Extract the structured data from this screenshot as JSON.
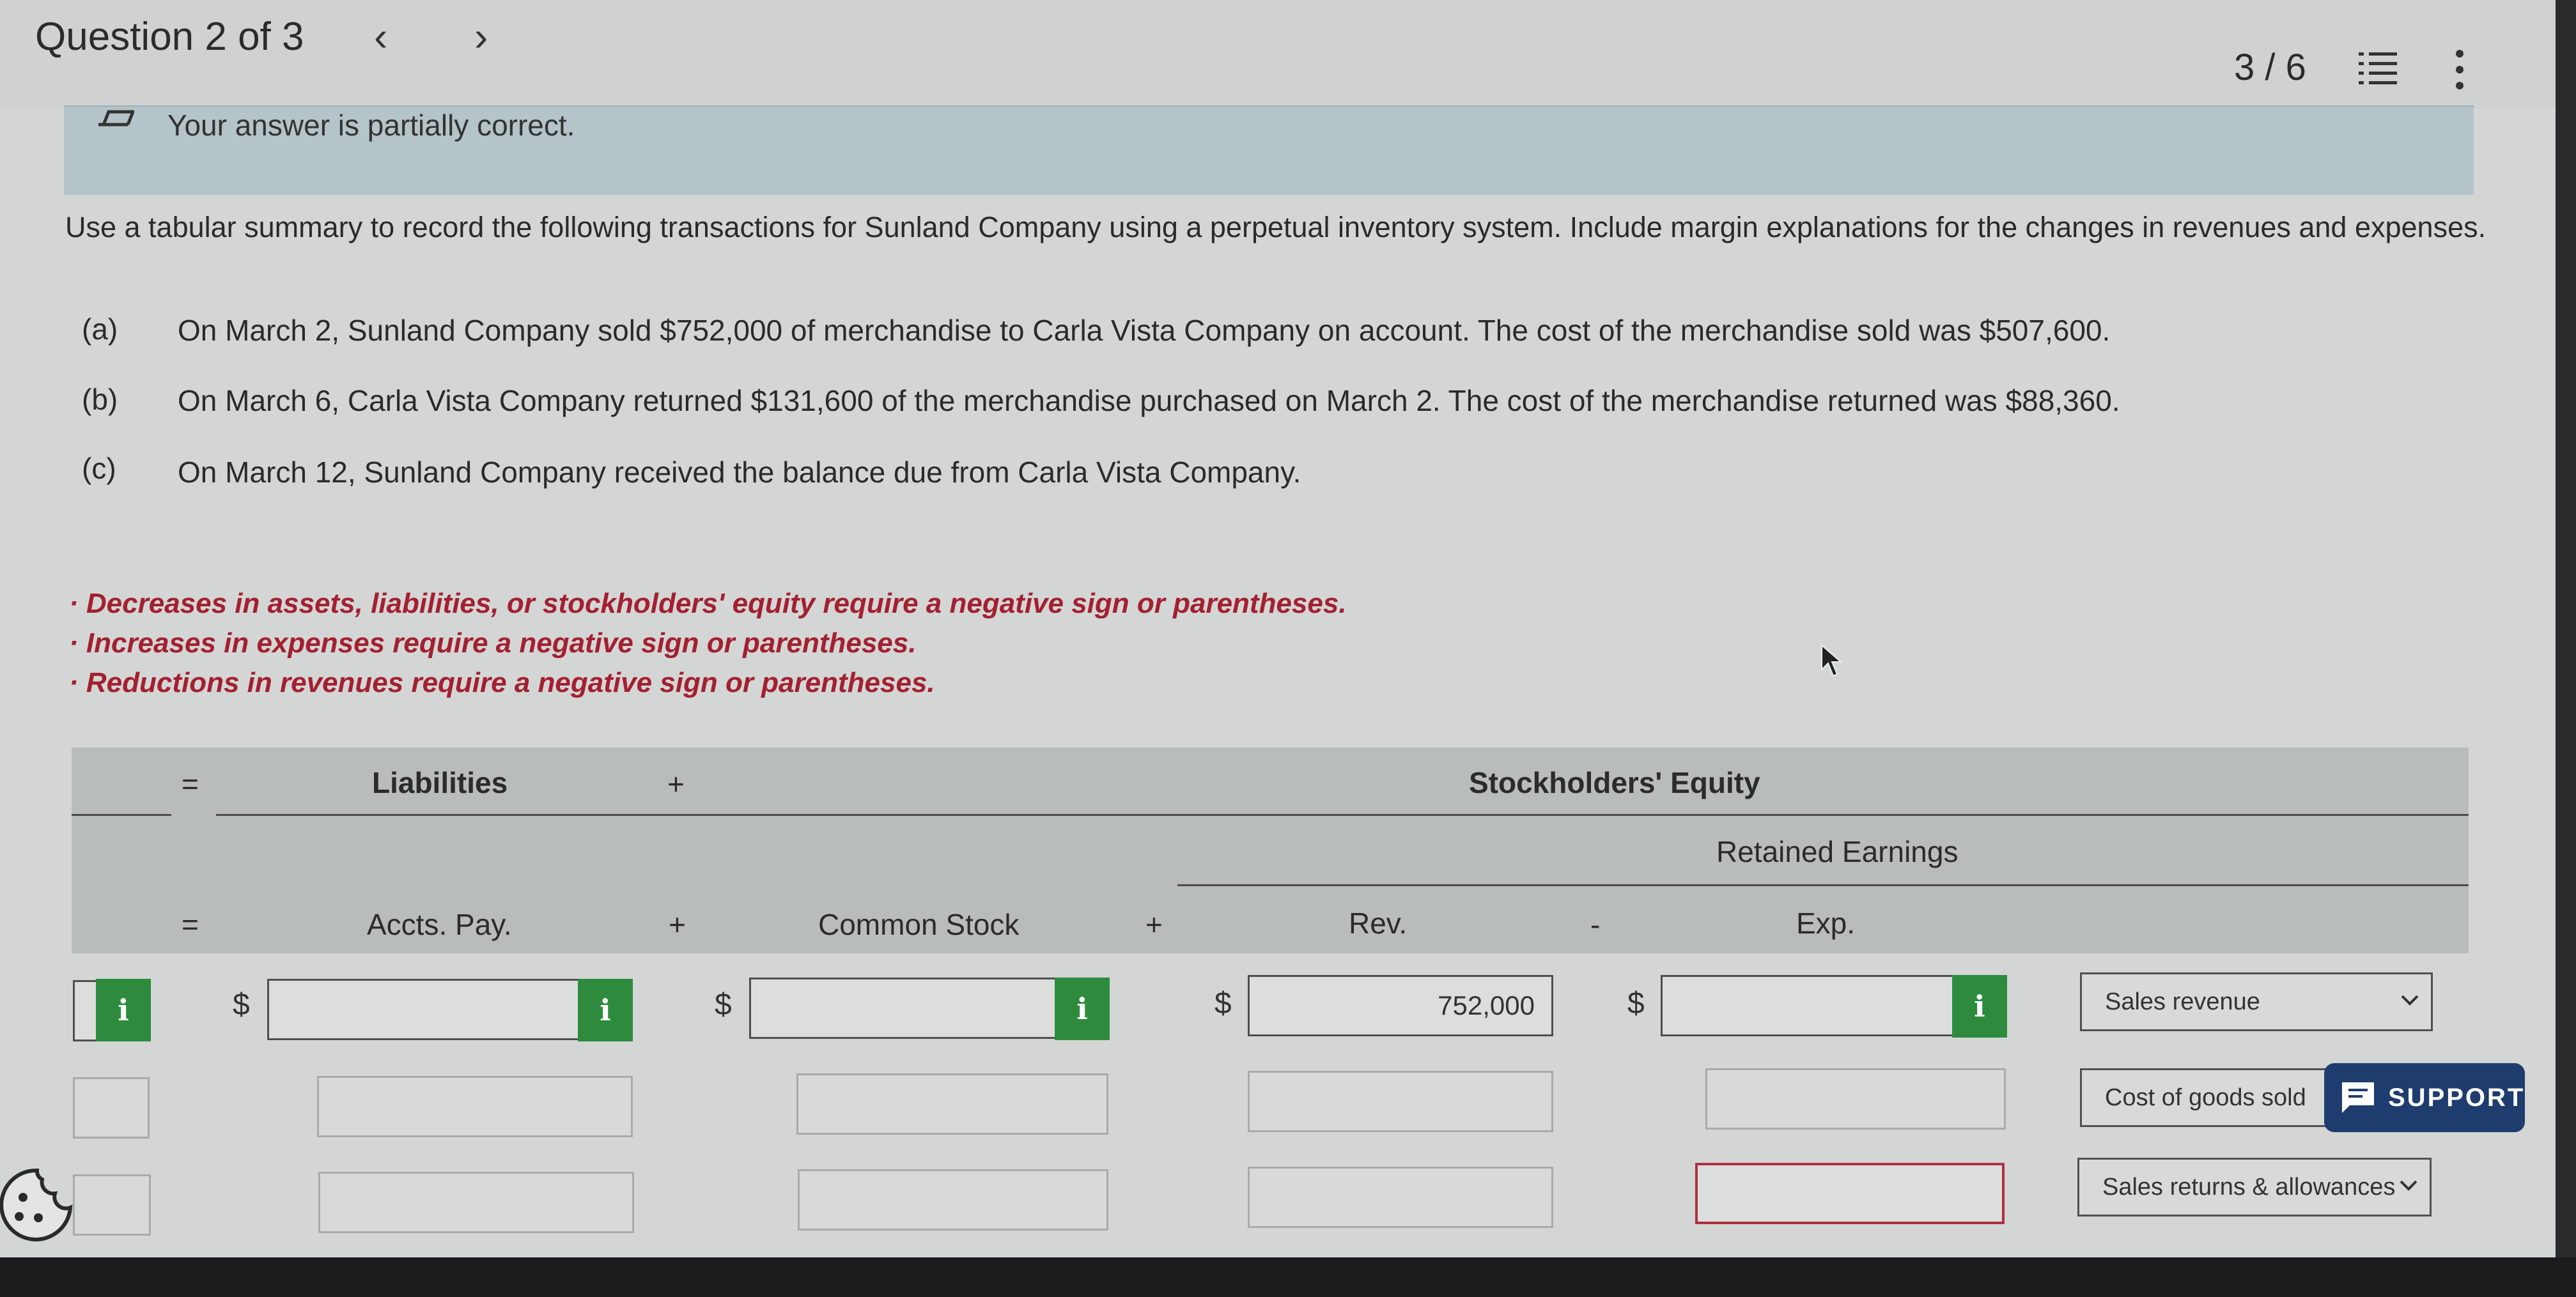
{
  "header": {
    "question_label": "Question 2 of 3",
    "prev_icon": "chevron-left-icon",
    "next_icon": "chevron-right-icon",
    "page_count": "3 / 6",
    "list_icon": "question-list-icon",
    "menu_icon": "more-options-icon"
  },
  "feedback": {
    "icon": "pencil-icon",
    "message": "Your answer is partially correct."
  },
  "problem": {
    "instructions": "Use a tabular summary to record the following transactions for Sunland Company using a perpetual inventory system. Include margin explanations for the changes in revenues and expenses.",
    "items": [
      {
        "label": "(a)",
        "text": "On March 2, Sunland Company sold $752,000 of merchandise to Carla Vista Company on account. The cost of the merchandise sold was $507,600."
      },
      {
        "label": "(b)",
        "text": "On March 6, Carla Vista Company returned $131,600 of the merchandise purchased on March 2. The cost of the merchandise returned was $88,360."
      },
      {
        "label": "(c)",
        "text": "On March 12, Sunland Company received the balance due from Carla Vista Company."
      }
    ],
    "notes": [
      "· Decreases in assets, liabilities, or stockholders' equity require a negative sign or parentheses.",
      "· Increases in expenses require a negative sign or parentheses.",
      "· Reductions in revenues require a negative sign or parentheses."
    ]
  },
  "table": {
    "equals_sign": "=",
    "plus_sign": "+",
    "minus_sign": "-",
    "liabilities": "Liabilities",
    "stockholders_equity": "Stockholders' Equity",
    "retained_earnings": "Retained Earnings",
    "accts_pay": "Accts. Pay.",
    "common_stock": "Common Stock",
    "rev": "Rev.",
    "exp": "Exp.",
    "currency": "$",
    "info_label": "i",
    "rows": [
      {
        "accts_pay": "",
        "common_stock": "",
        "rev": "752,000",
        "exp": "",
        "explanation": "Sales revenue"
      },
      {
        "accts_pay": "",
        "common_stock": "",
        "rev": "",
        "exp": "",
        "explanation": "Cost of goods sold"
      },
      {
        "accts_pay": "",
        "common_stock": "",
        "rev": "",
        "exp": "",
        "explanation": "Sales returns & allowances"
      }
    ]
  },
  "support": {
    "label": "SUPPORT",
    "icon": "chat-icon"
  },
  "colors": {
    "error": "#b03040",
    "info_button": "#2e8b3e",
    "support": "#1e3c6d",
    "feedback_bg": "#b4c4c8"
  }
}
